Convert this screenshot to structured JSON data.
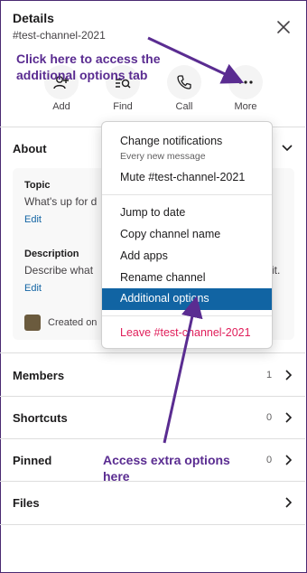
{
  "header": {
    "title": "Details",
    "channel": "#test-channel-2021"
  },
  "actions": [
    {
      "label": "Add",
      "icon": "add-people-icon"
    },
    {
      "label": "Find",
      "icon": "find-icon"
    },
    {
      "label": "Call",
      "icon": "phone-icon"
    },
    {
      "label": "More",
      "icon": "more-icon"
    }
  ],
  "about": {
    "title": "About",
    "topic_label": "Topic",
    "topic_text": "What's up for d",
    "topic_edit": "Edit",
    "description_label": "Description",
    "description_text": "Describe what",
    "description_tail": "it.",
    "description_edit": "Edit",
    "created_text": "Created on"
  },
  "rows": [
    {
      "label": "Members",
      "count": "1"
    },
    {
      "label": "Shortcuts",
      "count": "0"
    },
    {
      "label": "Pinned",
      "count": "0"
    },
    {
      "label": "Files",
      "count": ""
    }
  ],
  "menu": {
    "change_notifications": "Change notifications",
    "change_notifications_sub": "Every new message",
    "mute": "Mute #test-channel-2021",
    "jump_to_date": "Jump to date",
    "copy_channel_name": "Copy channel name",
    "add_apps": "Add apps",
    "rename_channel": "Rename channel",
    "additional_options": "Additional options",
    "leave": "Leave #test-channel-2021"
  },
  "annotations": {
    "top_line1": "Click here to access the",
    "top_line2": "additional options tab",
    "bottom_line1": "Access extra options",
    "bottom_line2": "here"
  },
  "colors": {
    "accent": "#1164a3",
    "annotation": "#5a2c91",
    "leave": "#e01e5a",
    "link": "#1264a3"
  }
}
